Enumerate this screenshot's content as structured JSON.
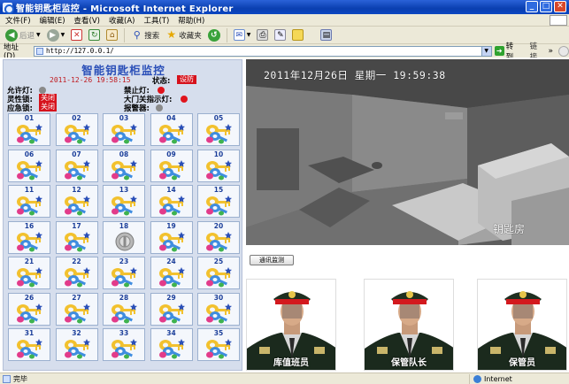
{
  "window": {
    "title": "智能钥匙柜监控 - Microsoft Internet Explorer",
    "min": "_",
    "max": "□",
    "close": "✕"
  },
  "menu": [
    "文件(F)",
    "编辑(E)",
    "查看(V)",
    "收藏(A)",
    "工具(T)",
    "帮助(H)"
  ],
  "toolbar": {
    "back_label": "后退",
    "search_label": "搜索",
    "favorites_label": "收藏夹"
  },
  "address": {
    "label": "地址(D)",
    "url": "http://127.0.0.1/",
    "go_label": "转到",
    "links_label": "链接"
  },
  "panel": {
    "title": "智能钥匙柜监控",
    "datetime": "2011-12-26 19:58:15",
    "status_label": "状态:",
    "status_value": "设防",
    "indicators": {
      "allow_light": {
        "label": "允许灯:",
        "color": "#8a8a8a"
      },
      "forbid_light": {
        "label": "禁止灯:",
        "color": "#e0141c"
      },
      "sensitive_lock": {
        "label": "灵性锁:",
        "value": "关闭"
      },
      "door_light": {
        "label": "大门关指示灯:",
        "color": "#e0141c"
      },
      "emergency_lock": {
        "label": "应急锁:",
        "value": "关闭"
      },
      "alarm": {
        "label": "报警器:",
        "color": "#8a8a8a"
      }
    },
    "slots": [
      "01",
      "02",
      "03",
      "04",
      "05",
      "06",
      "07",
      "08",
      "09",
      "10",
      "11",
      "12",
      "13",
      "14",
      "15",
      "16",
      "17",
      "18",
      "19",
      "20",
      "21",
      "22",
      "23",
      "24",
      "25",
      "26",
      "27",
      "28",
      "29",
      "30",
      "31",
      "32",
      "33",
      "34",
      "35"
    ],
    "empty_slot": "18"
  },
  "camera": {
    "osd": "2011年12月26日  星期一  19:59:38",
    "location": "钥匙房"
  },
  "comm_button": "通讯监测",
  "staff": [
    {
      "role": "库值班员"
    },
    {
      "role": "保管队长"
    },
    {
      "role": "保管员"
    }
  ],
  "statusbar": {
    "text": "完毕",
    "zone": "Internet"
  }
}
